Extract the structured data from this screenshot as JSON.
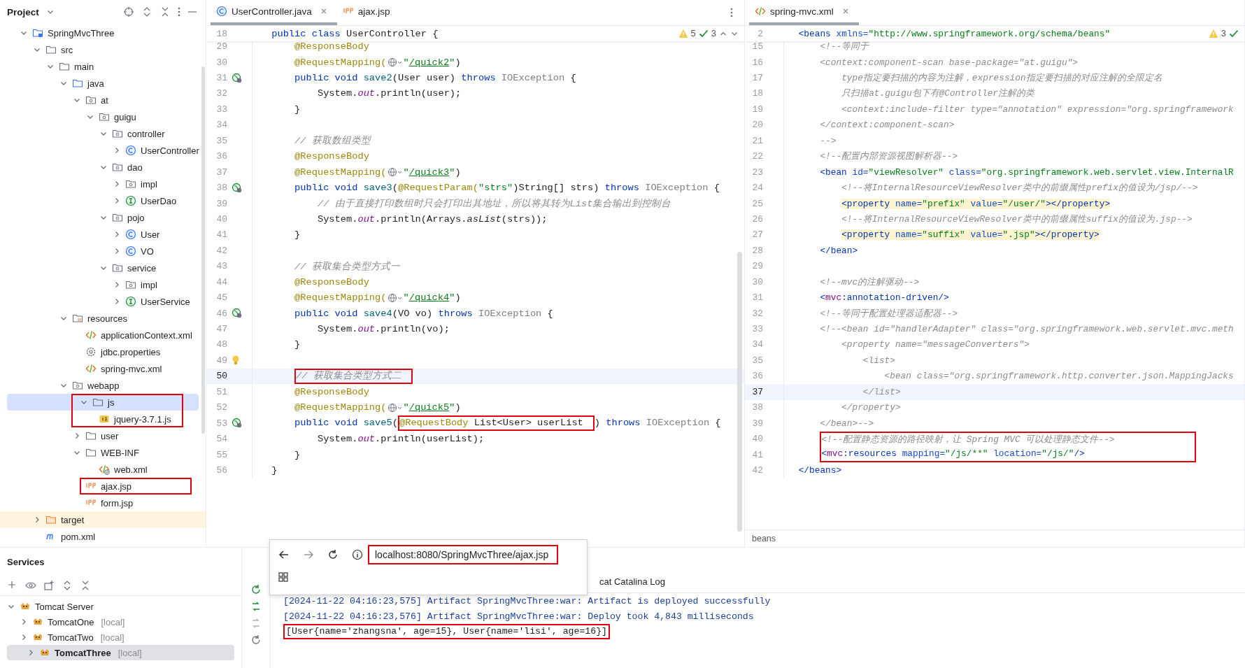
{
  "project_panel": {
    "title": "Project",
    "tree": [
      {
        "name": "SpringMvcThree",
        "kind": "module",
        "expanded": true,
        "selected": false,
        "children": [
          {
            "name": "src",
            "kind": "folder",
            "expanded": true,
            "selected": false,
            "children": [
              {
                "name": "main",
                "kind": "folder",
                "expanded": true,
                "selected": false,
                "children": [
                  {
                    "name": "java",
                    "kind": "source-folder",
                    "expanded": true,
                    "selected": false,
                    "children": [
                      {
                        "name": "at",
                        "kind": "package",
                        "expanded": true,
                        "selected": false,
                        "children": [
                          {
                            "name": "guigu",
                            "kind": "package",
                            "expanded": true,
                            "selected": false,
                            "children": [
                              {
                                "name": "controller",
                                "kind": "package",
                                "expanded": true,
                                "selected": false,
                                "children": [
                                  {
                                    "name": "UserController",
                                    "kind": "class",
                                    "expanded": false,
                                    "selected": false
                                  }
                                ]
                              },
                              {
                                "name": "dao",
                                "kind": "package",
                                "expanded": true,
                                "selected": false,
                                "children": [
                                  {
                                    "name": "impl",
                                    "kind": "package",
                                    "expanded": false,
                                    "selected": false
                                  },
                                  {
                                    "name": "UserDao",
                                    "kind": "interface",
                                    "expanded": false,
                                    "selected": false
                                  }
                                ]
                              },
                              {
                                "name": "pojo",
                                "kind": "package",
                                "expanded": true,
                                "selected": false,
                                "children": [
                                  {
                                    "name": "User",
                                    "kind": "class",
                                    "expanded": false,
                                    "selected": false
                                  },
                                  {
                                    "name": "VO",
                                    "kind": "class",
                                    "expanded": false,
                                    "selected": false
                                  }
                                ]
                              },
                              {
                                "name": "service",
                                "kind": "package",
                                "expanded": true,
                                "selected": false,
                                "children": [
                                  {
                                    "name": "impl",
                                    "kind": "package",
                                    "expanded": false,
                                    "selected": false
                                  },
                                  {
                                    "name": "UserService",
                                    "kind": "interface",
                                    "expanded": false,
                                    "selected": false
                                  }
                                ]
                              }
                            ]
                          }
                        ]
                      }
                    ]
                  },
                  {
                    "name": "resources",
                    "kind": "resource-folder",
                    "expanded": true,
                    "selected": false,
                    "children": [
                      {
                        "name": "applicationContext.xml",
                        "kind": "xml",
                        "selected": false
                      },
                      {
                        "name": "jdbc.properties",
                        "kind": "props",
                        "selected": false
                      },
                      {
                        "name": "spring-mvc.xml",
                        "kind": "xml",
                        "selected": false
                      }
                    ]
                  },
                  {
                    "name": "webapp",
                    "kind": "package",
                    "expanded": true,
                    "selected": false,
                    "children": [
                      {
                        "name": "js",
                        "kind": "folder",
                        "expanded": true,
                        "selected": true,
                        "boxed": true,
                        "children": [
                          {
                            "name": "jquery-3.7.1.js",
                            "kind": "js",
                            "selected": false
                          }
                        ]
                      },
                      {
                        "name": "user",
                        "kind": "folder",
                        "expanded": false,
                        "selected": false
                      },
                      {
                        "name": "WEB-INF",
                        "kind": "folder",
                        "expanded": true,
                        "selected": false,
                        "children": [
                          {
                            "name": "web.xml",
                            "kind": "web-xml",
                            "selected": false
                          }
                        ]
                      },
                      {
                        "name": "ajax.jsp",
                        "kind": "jsp",
                        "selected": false,
                        "boxed": true
                      },
                      {
                        "name": "form.jsp",
                        "kind": "jsp",
                        "selected": false
                      }
                    ]
                  }
                ]
              }
            ]
          },
          {
            "name": "target",
            "kind": "excluded-folder",
            "expanded": false,
            "selected": false
          },
          {
            "name": "pom.xml",
            "kind": "maven",
            "selected": false
          }
        ]
      }
    ]
  },
  "editor_left": {
    "tabs": [
      {
        "label": "UserController.java",
        "kind": "class",
        "selected": true,
        "closable": true
      },
      {
        "label": "ajax.jsp",
        "kind": "jsp",
        "selected": false,
        "closable": false
      }
    ],
    "inspections": {
      "warnings": "5",
      "checks": "3"
    },
    "sticky": {
      "number": "18",
      "tokens": [
        {
          "text": "public class ",
          "kind": "kw"
        },
        {
          "text": "UserController {",
          "kind": "plain"
        }
      ]
    },
    "lines": [
      {
        "number": "29",
        "kind": "plain",
        "tokens": [
          {
            "text": "    @ResponseBody",
            "kind": "ann"
          }
        ]
      },
      {
        "number": "30",
        "kind": "plain",
        "tokens": [
          {
            "text": "    @RequestMapping(",
            "kind": "ann"
          },
          {
            "kind": "globe"
          },
          {
            "text": "\"",
            "kind": "str"
          },
          {
            "text": "/quick2",
            "kind": "url"
          },
          {
            "text": "\"",
            "kind": "str"
          },
          {
            "text": ")",
            "kind": "plain"
          }
        ]
      },
      {
        "number": "31",
        "kind": "endpoint",
        "tokens": [
          {
            "text": "    public void ",
            "kind": "kw"
          },
          {
            "text": "save2",
            "kind": "fn"
          },
          {
            "text": "(User user) ",
            "kind": "plain"
          },
          {
            "text": "throws ",
            "kind": "kw"
          },
          {
            "text": "IOException",
            "kind": "dim"
          },
          {
            "text": " {",
            "kind": "plain"
          }
        ]
      },
      {
        "number": "32",
        "kind": "plain",
        "tokens": [
          {
            "text": "        System.",
            "kind": "plain"
          },
          {
            "text": "out",
            "kind": "field"
          },
          {
            "text": ".println(user);",
            "kind": "plain"
          }
        ]
      },
      {
        "number": "33",
        "kind": "plain",
        "tokens": [
          {
            "text": "    }",
            "kind": "plain"
          }
        ]
      },
      {
        "number": "34",
        "kind": "plain"
      },
      {
        "number": "35",
        "kind": "plain",
        "tokens": [
          {
            "text": "    // 获取数组类型",
            "kind": "cm"
          }
        ]
      },
      {
        "number": "36",
        "kind": "plain",
        "tokens": [
          {
            "text": "    @ResponseBody",
            "kind": "ann"
          }
        ]
      },
      {
        "number": "37",
        "kind": "plain",
        "tokens": [
          {
            "text": "    @RequestMapping(",
            "kind": "ann"
          },
          {
            "kind": "globe"
          },
          {
            "text": "\"",
            "kind": "str"
          },
          {
            "text": "/quick3",
            "kind": "url"
          },
          {
            "text": "\"",
            "kind": "str"
          },
          {
            "text": ")",
            "kind": "plain"
          }
        ]
      },
      {
        "number": "38",
        "kind": "endpoint",
        "tokens": [
          {
            "text": "    public void ",
            "kind": "kw"
          },
          {
            "text": "save3",
            "kind": "fn"
          },
          {
            "text": "(",
            "kind": "plain"
          },
          {
            "text": "@RequestParam(",
            "kind": "ann"
          },
          {
            "text": "\"strs\"",
            "kind": "str"
          },
          {
            "text": ")String[] strs) ",
            "kind": "plain"
          },
          {
            "text": "throws ",
            "kind": "kw"
          },
          {
            "text": "IOException",
            "kind": "dim"
          },
          {
            "text": " {",
            "kind": "plain"
          }
        ]
      },
      {
        "number": "39",
        "kind": "plain",
        "tokens": [
          {
            "text": "        // 由于直接打印数组时只会打印出其地址，所以将其转为List集合输出到控制台",
            "kind": "cm"
          }
        ]
      },
      {
        "number": "40",
        "kind": "plain",
        "tokens": [
          {
            "text": "        System.",
            "kind": "plain"
          },
          {
            "text": "out",
            "kind": "field"
          },
          {
            "text": ".println(Arrays.",
            "kind": "plain"
          },
          {
            "text": "asList",
            "kind": "italic"
          },
          {
            "text": "(strs));",
            "kind": "plain"
          }
        ]
      },
      {
        "number": "41",
        "kind": "plain",
        "tokens": [
          {
            "text": "    }",
            "kind": "plain"
          }
        ]
      },
      {
        "number": "42",
        "kind": "plain"
      },
      {
        "number": "43",
        "kind": "plain",
        "tokens": [
          {
            "text": "    // 获取集合类型方式一",
            "kind": "cm"
          }
        ]
      },
      {
        "number": "44",
        "kind": "plain",
        "tokens": [
          {
            "text": "    @ResponseBody",
            "kind": "ann"
          }
        ]
      },
      {
        "number": "45",
        "kind": "plain",
        "tokens": [
          {
            "text": "    @RequestMapping(",
            "kind": "ann"
          },
          {
            "kind": "globe"
          },
          {
            "text": "\"",
            "kind": "str"
          },
          {
            "text": "/quick4",
            "kind": "url"
          },
          {
            "text": "\"",
            "kind": "str"
          },
          {
            "text": ")",
            "kind": "plain"
          }
        ]
      },
      {
        "number": "46",
        "kind": "endpoint",
        "tokens": [
          {
            "text": "    public void ",
            "kind": "kw"
          },
          {
            "text": "save4",
            "kind": "fn"
          },
          {
            "text": "(VO vo) ",
            "kind": "plain"
          },
          {
            "text": "throws ",
            "kind": "kw"
          },
          {
            "text": "IOException",
            "kind": "dim"
          },
          {
            "text": " {",
            "kind": "plain"
          }
        ]
      },
      {
        "number": "47",
        "kind": "plain",
        "tokens": [
          {
            "text": "        System.",
            "kind": "plain"
          },
          {
            "text": "out",
            "kind": "field"
          },
          {
            "text": ".println(vo);",
            "kind": "plain"
          }
        ]
      },
      {
        "number": "48",
        "kind": "plain",
        "tokens": [
          {
            "text": "    }",
            "kind": "plain"
          }
        ]
      },
      {
        "number": "49",
        "kind": "bulb"
      },
      {
        "number": "50",
        "kind": "current",
        "tokens": [
          {
            "kind": "box",
            "tokens": [
              {
                "text": "    // 获取集合类型方式二",
                "kind": "cm"
              }
            ]
          }
        ]
      },
      {
        "number": "51",
        "kind": "plain",
        "tokens": [
          {
            "text": "    @ResponseBody",
            "kind": "ann"
          }
        ]
      },
      {
        "number": "52",
        "kind": "plain",
        "tokens": [
          {
            "text": "    @RequestMapping(",
            "kind": "ann"
          },
          {
            "kind": "globe"
          },
          {
            "text": "\"",
            "kind": "str"
          },
          {
            "text": "/quick5",
            "kind": "url"
          },
          {
            "text": "\"",
            "kind": "str"
          },
          {
            "text": ")",
            "kind": "plain"
          }
        ]
      },
      {
        "number": "53",
        "kind": "endpoint",
        "tokens": [
          {
            "text": "    public void ",
            "kind": "kw"
          },
          {
            "text": "save5",
            "kind": "fn"
          },
          {
            "text": "(",
            "kind": "plain"
          },
          {
            "kind": "box",
            "tokens": [
              {
                "text": "@RequestBody",
                "kind": "ann"
              },
              {
                "text": " List<User> userList",
                "kind": "plain"
              }
            ]
          },
          {
            "text": ") ",
            "kind": "plain"
          },
          {
            "text": "throws ",
            "kind": "kw"
          },
          {
            "text": "IOException",
            "kind": "dim"
          },
          {
            "text": " {",
            "kind": "plain"
          }
        ]
      },
      {
        "number": "54",
        "kind": "plain",
        "tokens": [
          {
            "text": "        System.",
            "kind": "plain"
          },
          {
            "text": "out",
            "kind": "field"
          },
          {
            "text": ".println(userList);",
            "kind": "plain"
          }
        ]
      },
      {
        "number": "55",
        "kind": "plain",
        "tokens": [
          {
            "text": "    }",
            "kind": "plain"
          }
        ]
      },
      {
        "number": "56",
        "kind": "plain",
        "tokens": [
          {
            "text": "}",
            "kind": "plain"
          }
        ]
      }
    ]
  },
  "editor_right": {
    "tabs": [
      {
        "label": "spring-mvc.xml",
        "kind": "xml",
        "selected": true,
        "closable": true
      }
    ],
    "inspections": {
      "warnings": "3"
    },
    "sticky": {
      "number": "2",
      "tokens": [
        {
          "text": "<beans ",
          "kind": "tag"
        },
        {
          "text": "xmlns=",
          "kind": "attr"
        },
        {
          "text": "\"http://www.springframework.org/schema/beans\"",
          "kind": "val"
        }
      ]
    },
    "lines": [
      {
        "number": "15",
        "kind": "plain",
        "tokens": [
          {
            "text": "    <!--等同于",
            "kind": "cm"
          }
        ]
      },
      {
        "number": "16",
        "kind": "plain",
        "tokens": [
          {
            "text": "    <context:component-scan base-package=\"at.guigu\">",
            "kind": "cm"
          }
        ]
      },
      {
        "number": "17",
        "kind": "plain",
        "tokens": [
          {
            "text": "        type指定要扫描的内容为注解，expression指定要扫描的对应注解的全限定名",
            "kind": "cm"
          }
        ]
      },
      {
        "number": "18",
        "kind": "plain",
        "tokens": [
          {
            "text": "        只扫描at.guigu包下有@Controller注解的类",
            "kind": "cm"
          }
        ]
      },
      {
        "number": "19",
        "kind": "plain",
        "tokens": [
          {
            "text": "        <context:include-filter type=\"annotation\" expression=\"org.springframework",
            "kind": "cm"
          }
        ]
      },
      {
        "number": "20",
        "kind": "plain",
        "tokens": [
          {
            "text": "    </context:component-scan>",
            "kind": "cm"
          }
        ]
      },
      {
        "number": "21",
        "kind": "plain",
        "tokens": [
          {
            "text": "    -->",
            "kind": "cm"
          }
        ]
      },
      {
        "number": "22",
        "kind": "plain",
        "tokens": [
          {
            "text": "    <!--配置内部资源视图解析器-->",
            "kind": "cm"
          }
        ]
      },
      {
        "number": "23",
        "kind": "plain",
        "tokens": [
          {
            "text": "    <bean ",
            "kind": "tag"
          },
          {
            "text": "id=",
            "kind": "attr"
          },
          {
            "text": "\"viewResolver\" ",
            "kind": "val"
          },
          {
            "text": "class=",
            "kind": "attr"
          },
          {
            "text": "\"org.springframework.web.servlet.view.InternalR",
            "kind": "val"
          }
        ]
      },
      {
        "number": "24",
        "kind": "plain",
        "tokens": [
          {
            "text": "        <!--将InternalResourceViewResolver类中的前缀属性prefix的值设为/jsp/-->",
            "kind": "cm"
          }
        ]
      },
      {
        "number": "25",
        "kind": "highlighted",
        "tokens": [
          {
            "text": "        <property ",
            "kind": "tag"
          },
          {
            "text": "name=",
            "kind": "attr"
          },
          {
            "text": "\"prefix\" ",
            "kind": "val"
          },
          {
            "text": "value=",
            "kind": "attr"
          },
          {
            "text": "\"/user/\"",
            "kind": "val"
          },
          {
            "text": "></property>",
            "kind": "tag"
          }
        ]
      },
      {
        "number": "26",
        "kind": "plain",
        "tokens": [
          {
            "text": "        <!--将InternalResourceViewResolver类中的前缀属性suffix的值设为.jsp-->",
            "kind": "cm"
          }
        ]
      },
      {
        "number": "27",
        "kind": "highlighted",
        "tokens": [
          {
            "text": "        <property ",
            "kind": "tag"
          },
          {
            "text": "name=",
            "kind": "attr"
          },
          {
            "text": "\"suffix\" ",
            "kind": "val"
          },
          {
            "text": "value=",
            "kind": "attr"
          },
          {
            "text": "\".jsp\"",
            "kind": "val"
          },
          {
            "text": "></property>",
            "kind": "tag"
          }
        ]
      },
      {
        "number": "28",
        "kind": "plain",
        "tokens": [
          {
            "text": "    </bean>",
            "kind": "tag"
          }
        ]
      },
      {
        "number": "29",
        "kind": "plain"
      },
      {
        "number": "30",
        "kind": "plain",
        "tokens": [
          {
            "text": "    <!--mvc的注解驱动-->",
            "kind": "cm"
          }
        ]
      },
      {
        "number": "31",
        "kind": "plain",
        "tokens": [
          {
            "text": "    <",
            "kind": "tag"
          },
          {
            "text": "mvc",
            "kind": "ns"
          },
          {
            "text": ":annotation-driven/>",
            "kind": "tag"
          }
        ]
      },
      {
        "number": "32",
        "kind": "plain",
        "tokens": [
          {
            "text": "    <!--等同于配置处理器适配器-->",
            "kind": "cm"
          }
        ]
      },
      {
        "number": "33",
        "kind": "plain",
        "tokens": [
          {
            "text": "    <!--<bean id=\"handlerAdapter\" class=\"org.springframework.web.servlet.mvc.meth",
            "kind": "cm"
          }
        ]
      },
      {
        "number": "34",
        "kind": "plain",
        "tokens": [
          {
            "text": "        <property name=\"messageConverters\">",
            "kind": "cm"
          }
        ]
      },
      {
        "number": "35",
        "kind": "plain",
        "tokens": [
          {
            "text": "            <list>",
            "kind": "cm"
          }
        ]
      },
      {
        "number": "36",
        "kind": "plain",
        "tokens": [
          {
            "text": "                <bean class=\"org.springframework.http.converter.json.MappingJacks",
            "kind": "cm"
          }
        ]
      },
      {
        "number": "37",
        "kind": "current",
        "tokens": [
          {
            "text": "            </list>",
            "kind": "cm"
          }
        ]
      },
      {
        "number": "38",
        "kind": "plain",
        "tokens": [
          {
            "text": "        </property>",
            "kind": "cm"
          }
        ]
      },
      {
        "number": "39",
        "kind": "plain",
        "tokens": [
          {
            "text": "    </bean>-->",
            "kind": "cm"
          }
        ]
      },
      {
        "number": "40",
        "kind": "plain",
        "tokens": [
          {
            "kind": "box",
            "tokens": [
              {
                "text": "    <!--配置静态资源的路径映射，让 Spring MVC 可以处理静态文件-->",
                "kind": "cm"
              }
            ]
          }
        ]
      },
      {
        "number": "41",
        "kind": "plain",
        "tokens": [
          {
            "kind": "box",
            "tokens": [
              {
                "text": "    <",
                "kind": "tag"
              },
              {
                "text": "mvc",
                "kind": "ns"
              },
              {
                "text": ":resources ",
                "kind": "tag"
              },
              {
                "text": "mapping=",
                "kind": "attr"
              },
              {
                "text": "\"/js/**\" ",
                "kind": "val"
              },
              {
                "text": "location=",
                "kind": "attr"
              },
              {
                "text": "\"/js/\"",
                "kind": "val"
              },
              {
                "text": "/>",
                "kind": "tag"
              }
            ]
          }
        ]
      },
      {
        "number": "42",
        "kind": "plain",
        "tokens": [
          {
            "text": "</beans>",
            "kind": "tag"
          }
        ]
      }
    ],
    "breadcrumb": "beans"
  },
  "browser_popup": {
    "url": "localhost:8080/SpringMvcThree/ajax.jsp",
    "boxed": true
  },
  "services": {
    "title": "Services",
    "tree": [
      {
        "name": "Tomcat Server",
        "expanded": true,
        "selected": false,
        "children": [
          {
            "name": "TomcatOne",
            "note": "[local]",
            "expanded": false,
            "selected": false
          },
          {
            "name": "TomcatTwo",
            "note": "[local]",
            "expanded": false,
            "selected": false
          },
          {
            "name": "TomcatThree",
            "note": "[local]",
            "expanded": false,
            "selected": true
          }
        ]
      }
    ],
    "console": {
      "tab": "cat Catalina Log",
      "lines": [
        {
          "kind": "info",
          "text": "[2024-11-22 04:16:23,575] Artifact SpringMvcThree:war: Artifact is deployed successfully",
          "boxed": false
        },
        {
          "kind": "info",
          "text": "[2024-11-22 04:16:23,576] Artifact SpringMvcThree:war: Deploy took 4,843 milliseconds",
          "boxed": false
        },
        {
          "kind": "output",
          "text": "[User{name='zhangsna', age=15}, User{name='lisi', age=16}]",
          "boxed": true
        }
      ]
    }
  }
}
